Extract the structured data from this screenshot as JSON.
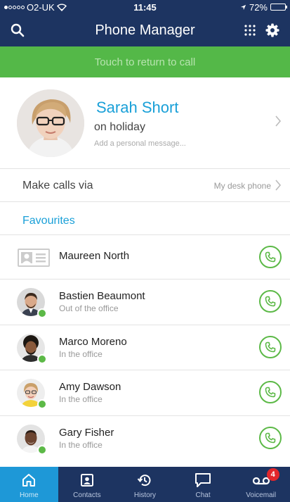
{
  "status_bar": {
    "carrier": "O2-UK",
    "time": "11:45",
    "battery": "72%",
    "battery_level": 0.72
  },
  "header": {
    "title": "Phone Manager"
  },
  "call_banner": {
    "text": "Touch to return to call"
  },
  "profile": {
    "name": "Sarah Short",
    "status": "on holiday",
    "message_placeholder": "Add a personal message..."
  },
  "make_calls": {
    "label": "Make calls via",
    "value": "My desk phone"
  },
  "favourites": {
    "title": "Favourites",
    "items": [
      {
        "name": "Maureen North",
        "status": ""
      },
      {
        "name": "Bastien Beaumont",
        "status": "Out of the office"
      },
      {
        "name": "Marco Moreno",
        "status": "In the office"
      },
      {
        "name": "Amy Dawson",
        "status": "In the office"
      },
      {
        "name": "Gary Fisher",
        "status": "In the office"
      }
    ]
  },
  "tabs": [
    {
      "label": "Home",
      "icon": "home-icon",
      "active": true
    },
    {
      "label": "Contacts",
      "icon": "contacts-icon"
    },
    {
      "label": "History",
      "icon": "history-icon"
    },
    {
      "label": "Chat",
      "icon": "chat-icon"
    },
    {
      "label": "Voicemail",
      "icon": "voicemail-icon",
      "badge": "4"
    }
  ],
  "colors": {
    "header": "#1d3461",
    "banner": "#54b848",
    "accent": "#1aa0d8",
    "presence_available": "#5cb947",
    "badge": "#e3262b"
  }
}
